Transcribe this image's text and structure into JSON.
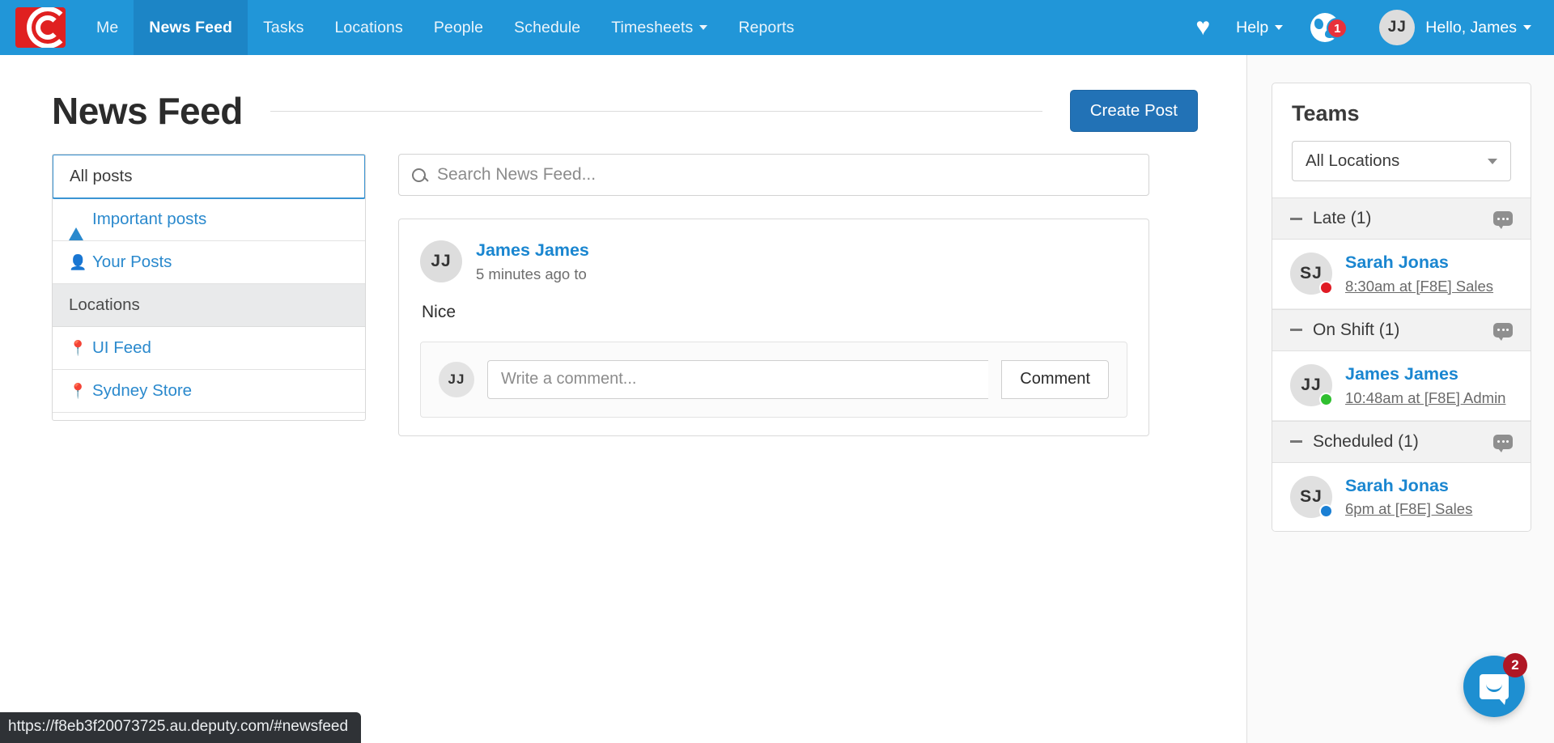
{
  "nav": {
    "logo_alt": "deputy-logo",
    "items": [
      {
        "label": "Me",
        "active": false,
        "has_caret": false
      },
      {
        "label": "News Feed",
        "active": true,
        "has_caret": false
      },
      {
        "label": "Tasks",
        "active": false,
        "has_caret": false
      },
      {
        "label": "Locations",
        "active": false,
        "has_caret": false
      },
      {
        "label": "People",
        "active": false,
        "has_caret": false
      },
      {
        "label": "Schedule",
        "active": false,
        "has_caret": false
      },
      {
        "label": "Timesheets",
        "active": false,
        "has_caret": true
      },
      {
        "label": "Reports",
        "active": false,
        "has_caret": false
      }
    ],
    "help_label": "Help",
    "globe_badge": "1",
    "user_initials": "JJ",
    "user_greeting": "Hello, James",
    "bar_color": "#2196d8",
    "active_color": "#1c85c6"
  },
  "header": {
    "title": "News Feed",
    "create_post_label": "Create Post"
  },
  "filters": {
    "items": [
      {
        "label": "All posts",
        "icon": "none",
        "selected": true,
        "group": false
      },
      {
        "label": "Important posts",
        "icon": "warning-icon",
        "selected": false,
        "group": false
      },
      {
        "label": "Your Posts",
        "icon": "user-icon",
        "selected": false,
        "group": false
      },
      {
        "label": "Locations",
        "icon": "none",
        "selected": false,
        "group": true
      },
      {
        "label": "UI Feed",
        "icon": "map-pin-icon",
        "selected": false,
        "group": false
      },
      {
        "label": "Sydney Store",
        "icon": "map-pin-icon",
        "selected": false,
        "group": false
      }
    ]
  },
  "search": {
    "placeholder": "Search News Feed...",
    "value": ""
  },
  "posts": [
    {
      "avatar_initials": "JJ",
      "author": "James James",
      "meta": "5 minutes ago to",
      "body": "Nice",
      "comment_avatar": "JJ",
      "comment_placeholder": "Write a comment...",
      "comment_value": "",
      "comment_button": "Comment"
    }
  ],
  "teams": {
    "title": "Teams",
    "location_filter": "All Locations",
    "groups": [
      {
        "label": "Late (1)",
        "members": [
          {
            "initials": "SJ",
            "name": "Sarah Jonas",
            "detail": "8:30am at [F8E] Sales",
            "status_color": "#e01b24"
          }
        ]
      },
      {
        "label": "On Shift (1)",
        "members": [
          {
            "initials": "JJ",
            "name": "James James",
            "detail": "10:48am at [F8E] Admin",
            "status_color": "#2fbf2f"
          }
        ]
      },
      {
        "label": "Scheduled (1)",
        "members": [
          {
            "initials": "SJ",
            "name": "Sarah Jonas",
            "detail": "6pm at [F8E] Sales",
            "status_color": "#1a7fd4"
          }
        ]
      }
    ]
  },
  "chat_widget": {
    "badge": "2",
    "color": "#1e8fd1"
  },
  "status_bar": {
    "url": "https://f8eb3f20073725.au.deputy.com/#newsfeed"
  }
}
